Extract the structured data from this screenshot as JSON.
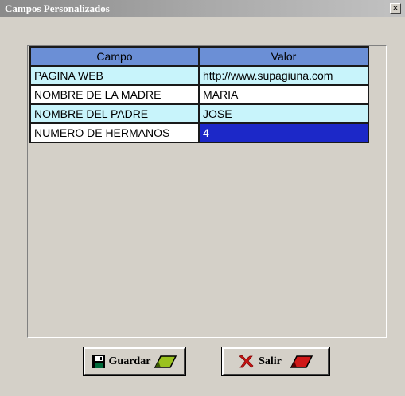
{
  "window": {
    "title": "Campos Personalizados",
    "close_glyph": "×"
  },
  "grid": {
    "columns": [
      "Campo",
      "Valor"
    ],
    "header_color": "#6b8fd6",
    "alt_row_color": "#c8f4fb",
    "selected_color": "#1c28c8",
    "rows": [
      {
        "campo": "PAGINA WEB",
        "valor": "http://www.supagiuna.com"
      },
      {
        "campo": "NOMBRE DE LA MADRE",
        "valor": "MARIA"
      },
      {
        "campo": "NOMBRE DEL PADRE",
        "valor": "JOSE"
      },
      {
        "campo": "NUMERO DE HERMANOS",
        "valor": "4"
      }
    ]
  },
  "buttons": {
    "save_label": "Guardar",
    "save_icon": "floppy-disk-icon",
    "exit_label": "Salir",
    "exit_icon": "red-x-icon"
  }
}
